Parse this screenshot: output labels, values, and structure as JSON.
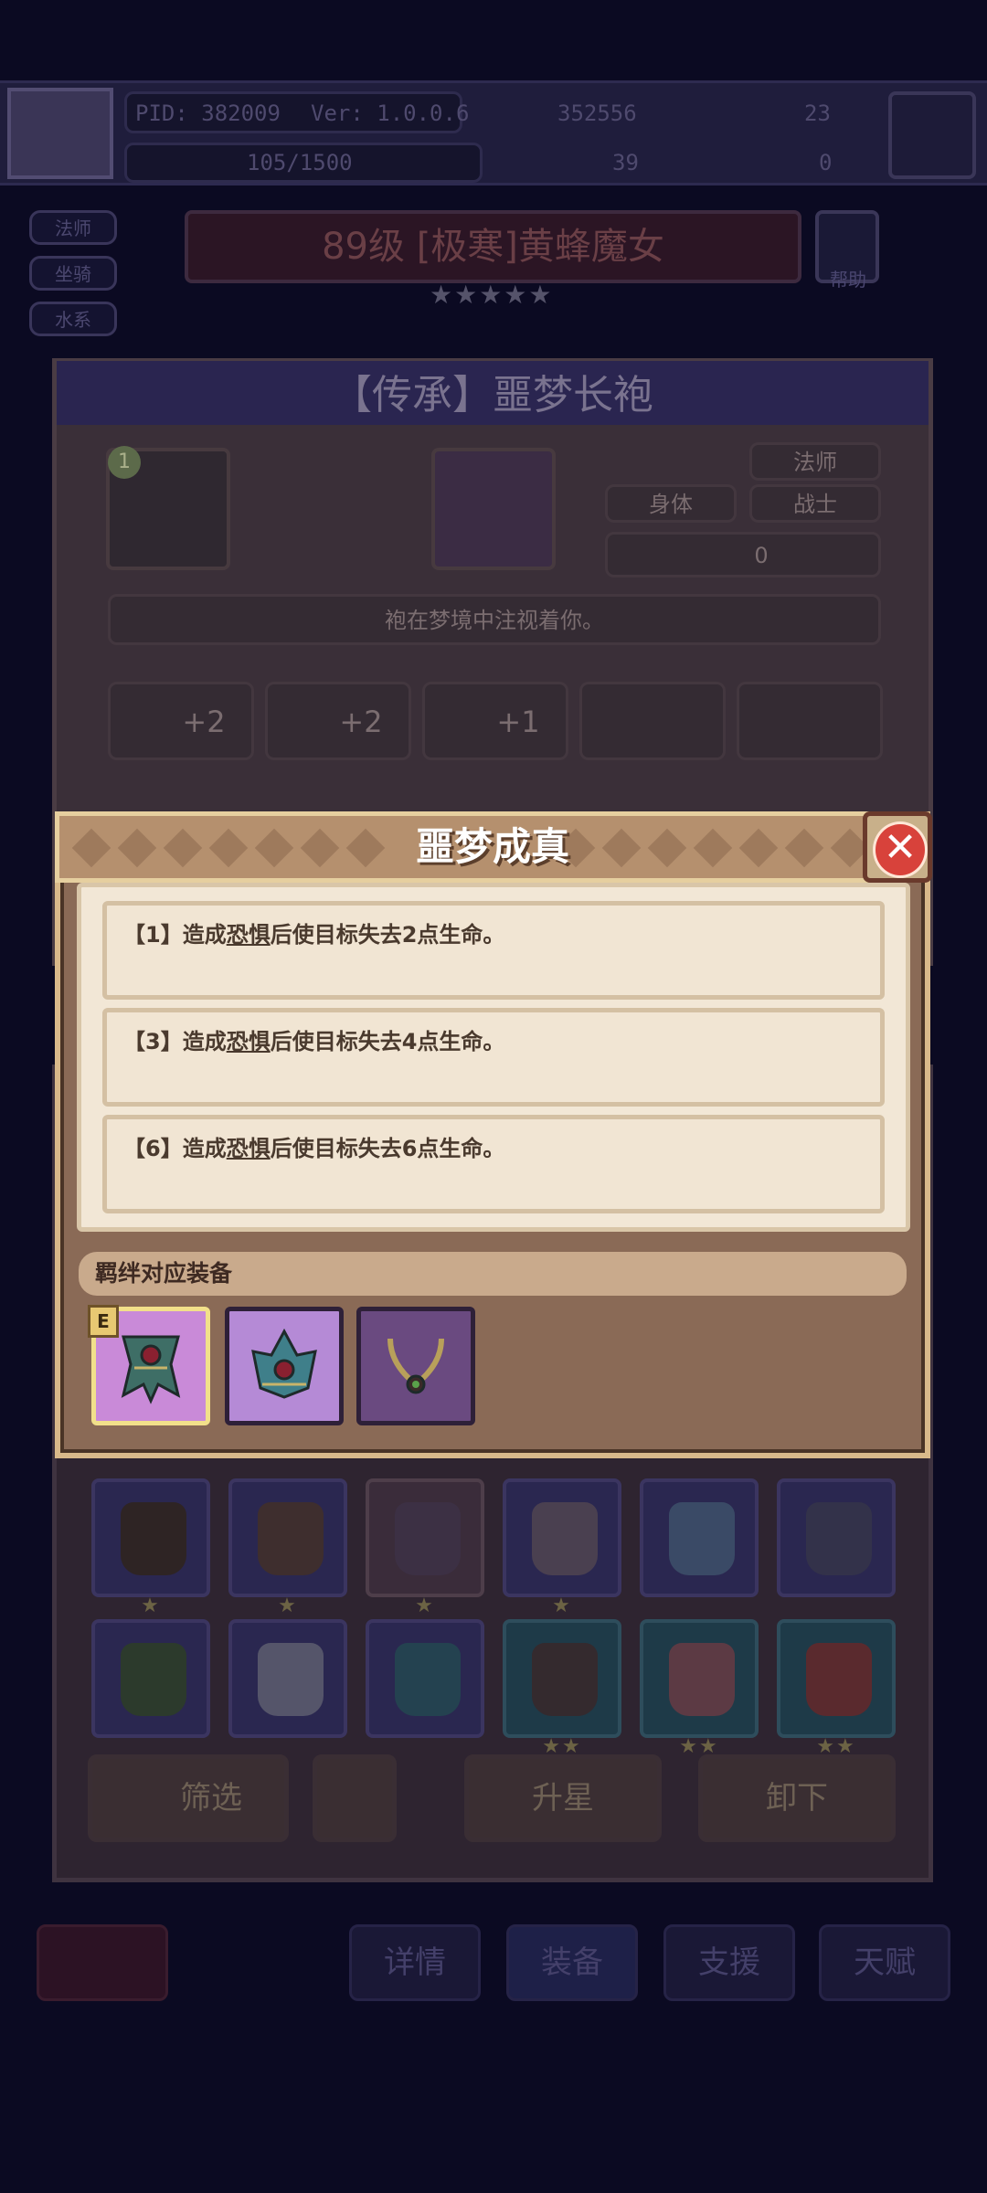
{
  "background": {
    "player": {
      "pid": "PID: 382009",
      "version": "Ver: 1.0.0.6",
      "gold": "352556",
      "gems": "23",
      "exp": "105/1500",
      "clover": "39",
      "tickets": "0"
    },
    "side_tags": [
      "法师",
      "坐骑",
      "水系"
    ],
    "hero_title": "89级 [极寒]黄蜂魔女",
    "help_label": "帮助",
    "item": {
      "title": "【传承】噩梦长袍",
      "tags": [
        "法师",
        "身体",
        "战士"
      ],
      "count_value": "0",
      "description": "袍在梦境中注视着你。",
      "stats": [
        "+2",
        "+2",
        "+1"
      ],
      "level_badge": "1"
    },
    "buttons": {
      "filter": "筛选",
      "upgrade": "升星",
      "unequip": "卸下"
    },
    "nav": [
      "详情",
      "装备",
      "支援",
      "天赋"
    ]
  },
  "modal": {
    "title": "噩梦成真",
    "effects": [
      {
        "prefix": "【1】造成",
        "keyword": "恐惧",
        "suffix": "后使目标失去2点生命。"
      },
      {
        "prefix": "【3】造成",
        "keyword": "恐惧",
        "suffix": "后使目标失去4点生命。"
      },
      {
        "prefix": "【6】造成",
        "keyword": "恐惧",
        "suffix": "后使目标失去6点生命。"
      }
    ],
    "bond_label": "羁绊对应装备",
    "equipped_mark": "E",
    "equipment": [
      "robe-icon",
      "crown-icon",
      "necklace-icon"
    ],
    "colors": {
      "accent_red": "#d8423b",
      "panel_tan": "#b5906e",
      "slot_purple": "#b58ad6"
    }
  }
}
